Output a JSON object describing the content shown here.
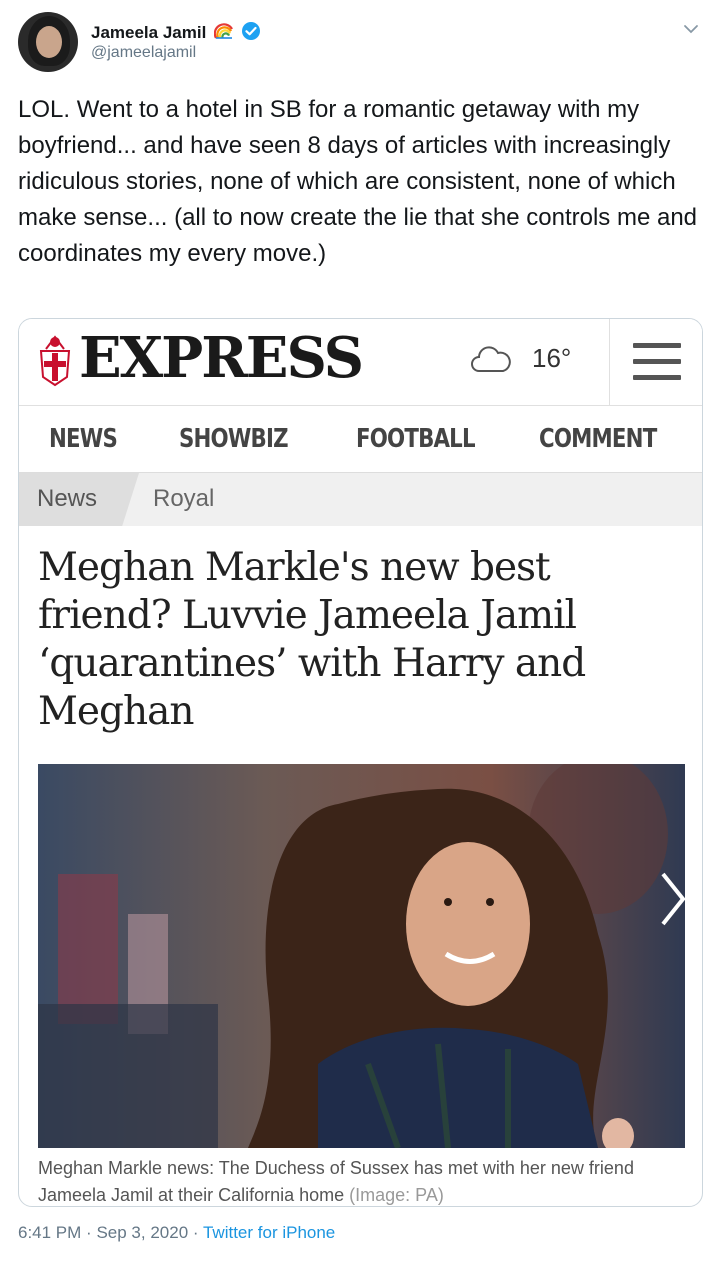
{
  "tweet": {
    "display_name": "Jameela Jamil",
    "handle": "@jameelajamil",
    "text": "LOL. Went to a hotel in SB for a romantic getaway with my boyfriend... and have seen 8 days of articles with increasingly ridiculous stories, none of which are consistent, none of which make sense... (all to now create the lie that she controls me and coordinates my every move.)",
    "time": "6:41 PM",
    "date": "Sep 3, 2020",
    "separator": "·",
    "source": "Twitter for iPhone",
    "icons": [
      "rainbow-flag-icon",
      "verified-badge-icon",
      "chevron-down-icon"
    ],
    "colors": {
      "text": "#14171a",
      "secondary": "#657786",
      "link": "#1b95e0",
      "verified": "#1da1f2"
    }
  },
  "article": {
    "brand": "EXPRESS",
    "weather_temp": "16°",
    "nav": [
      "NEWS",
      "SHOWBIZ",
      "FOOTBALL",
      "COMMENT"
    ],
    "breadcrumbs": [
      "News",
      "Royal"
    ],
    "headline": "Meghan Markle's new best friend? Luvvie Jameela Jamil ‘quarantines’ with Harry and Meghan",
    "caption": "Meghan Markle news: The Duchess of Sussex has met with her new friend Jameela Jamil at their California home",
    "credit": "(Image: PA)",
    "icons": [
      "express-crest-icon",
      "cloud-icon",
      "hamburger-menu-icon",
      "chevron-right-icon"
    ]
  }
}
